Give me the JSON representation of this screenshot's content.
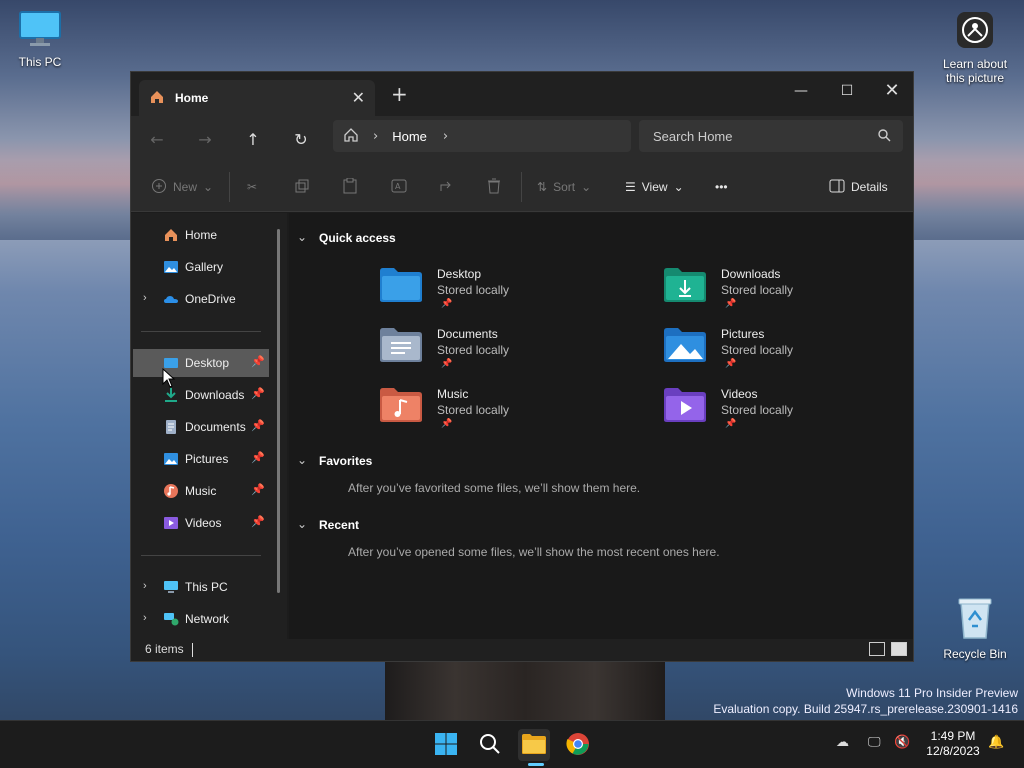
{
  "desktop": {
    "this_pc_label": "This PC",
    "learn_label": "Learn about this picture",
    "recycle_label": "Recycle Bin",
    "watermark_line1": "Windows 11 Pro Insider Preview",
    "watermark_line2": "Evaluation copy. Build 25947.rs_prerelease.230901-1416"
  },
  "window": {
    "tab_title": "Home",
    "new_tab_glyph": "+",
    "close_tab_glyph": "✕",
    "minimize_glyph": "—",
    "maximize_glyph": "☐",
    "close_glyph": "✕"
  },
  "nav": {
    "back_glyph": "←",
    "forward_glyph": "→",
    "up_glyph": "↑",
    "refresh_glyph": "↻",
    "breadcrumb": "Home",
    "search_placeholder": "Search Home"
  },
  "toolbar": {
    "new_label": "New",
    "sort_label": "Sort",
    "view_label": "View",
    "more_glyph": "•••",
    "details_label": "Details"
  },
  "sidebar": {
    "items": [
      {
        "label": "Home"
      },
      {
        "label": "Gallery"
      },
      {
        "label": "OneDrive"
      },
      {
        "label": "Desktop"
      },
      {
        "label": "Downloads"
      },
      {
        "label": "Documents"
      },
      {
        "label": "Pictures"
      },
      {
        "label": "Music"
      },
      {
        "label": "Videos"
      },
      {
        "label": "This PC"
      },
      {
        "label": "Network"
      }
    ]
  },
  "quick_access": {
    "title": "Quick access",
    "folders": [
      {
        "name": "Desktop",
        "status": "Stored locally",
        "color": "#3aa0e8"
      },
      {
        "name": "Downloads",
        "status": "Stored locally",
        "color": "#1fa98a"
      },
      {
        "name": "Documents",
        "status": "Stored locally",
        "color": "#8aa0bd"
      },
      {
        "name": "Pictures",
        "status": "Stored locally",
        "color": "#2f8fe0"
      },
      {
        "name": "Music",
        "status": "Stored locally",
        "color": "#e8755a"
      },
      {
        "name": "Videos",
        "status": "Stored locally",
        "color": "#8a5be0"
      }
    ]
  },
  "favorites": {
    "title": "Favorites",
    "message": "After you’ve favorited some files, we’ll show them here."
  },
  "recent": {
    "title": "Recent",
    "message": "After you’ve opened some files, we’ll show the most recent ones here."
  },
  "status": {
    "items_count": "6 items"
  },
  "taskbar": {
    "time": "1:49 PM",
    "date": "12/8/2023"
  }
}
